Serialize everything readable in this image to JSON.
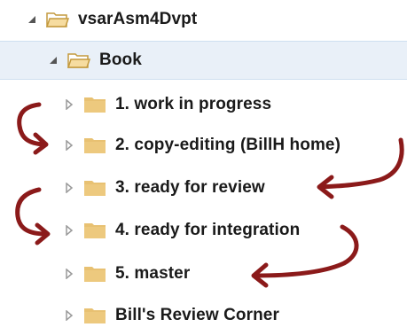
{
  "tree": {
    "root": {
      "label": "vsarAsm4Dvpt",
      "expanded": true
    },
    "book": {
      "label": "Book",
      "expanded": true,
      "selected": true
    },
    "items": [
      {
        "label": "1. work in progress"
      },
      {
        "label": "2. copy-editing (BillH home)"
      },
      {
        "label": "3. ready for review"
      },
      {
        "label": "4. ready for integration"
      },
      {
        "label": "5. master"
      },
      {
        "label": "Bill's Review Corner"
      }
    ]
  },
  "colors": {
    "folder_fill": "#e8c172",
    "folder_outline": "#c49a3e",
    "expanded_arrow": "#555555",
    "collapsed_arrow": "#9a9a9a",
    "annotation_arrow": "#8b1a1a",
    "selection_bg": "#e9f0f8"
  }
}
